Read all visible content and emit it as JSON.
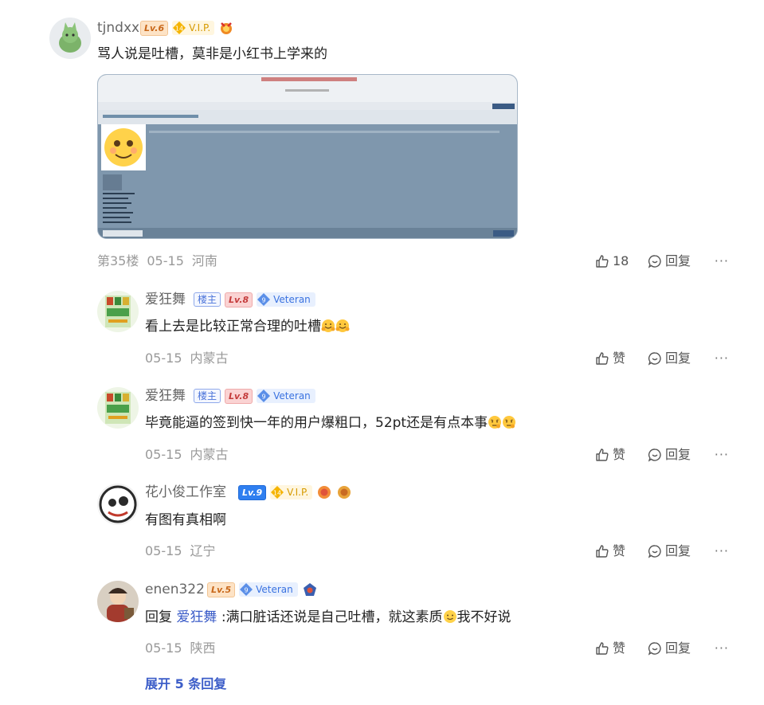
{
  "comments": [
    {
      "username": "tjndxx",
      "level": "Lv.6",
      "vip_count": "14",
      "vip_label": "V.I.P.",
      "text": "骂人说是吐槽，莫非是小红书上学来的",
      "floor": "第35楼",
      "date": "05-15",
      "location": "河南",
      "like_count": "18",
      "reply_label": "回复"
    },
    {
      "username": "爱狂舞",
      "owner_tag": "楼主",
      "level": "Lv.8",
      "veteran_count": "9",
      "veteran_label": "Veteran",
      "text": "看上去是比较正常合理的吐槽",
      "date": "05-15",
      "location": "内蒙古",
      "like_label": "赞",
      "reply_label": "回复"
    },
    {
      "username": "爱狂舞",
      "owner_tag": "楼主",
      "level": "Lv.8",
      "veteran_count": "9",
      "veteran_label": "Veteran",
      "text": "毕竟能逼的签到快一年的用户爆粗口，52pt还是有点本事",
      "date": "05-15",
      "location": "内蒙古",
      "like_label": "赞",
      "reply_label": "回复"
    },
    {
      "username": "花小俊工作室",
      "level": "Lv.9",
      "vip_count": "14",
      "vip_label": "V.I.P.",
      "text": "有图有真相啊",
      "date": "05-15",
      "location": "辽宁",
      "like_label": "赞",
      "reply_label": "回复"
    },
    {
      "username": "enen322",
      "level": "Lv.5",
      "veteran_count": "9",
      "veteran_label": "Veteran",
      "reply_prefix": "回复",
      "reply_to": "爱狂舞",
      "text": ":满口脏话还说是自己吐槽，就这素质",
      "text_tail": "我不好说",
      "date": "05-15",
      "location": "陕西",
      "like_label": "赞",
      "reply_label": "回复"
    }
  ],
  "more_label": "···",
  "expand_label": "展开 5 条回复",
  "colors": {
    "link": "#3c5dc8",
    "meta": "#999999",
    "screenshot_bg": "#7f97ad"
  },
  "icons": [
    "thumb-up-icon",
    "reply-bubble-icon",
    "more-dots-icon",
    "diamond-icon",
    "smile-emoji-icon"
  ]
}
